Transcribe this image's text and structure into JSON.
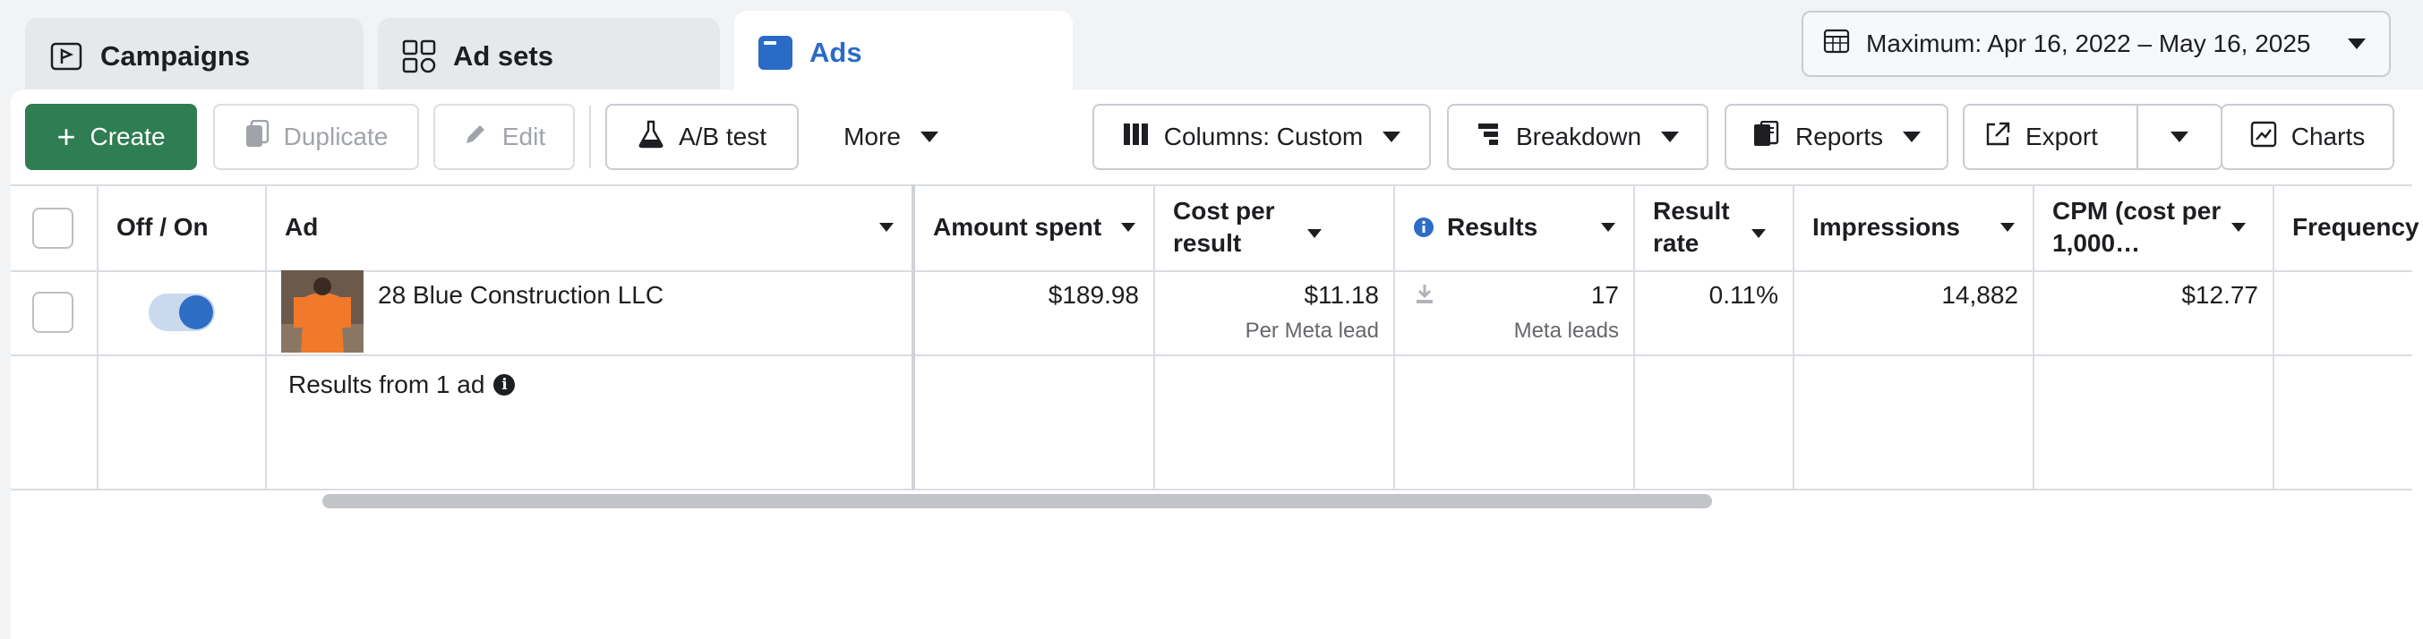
{
  "tabs": [
    {
      "label": "Campaigns",
      "icon": "campaign-flag-icon"
    },
    {
      "label": "Ad sets",
      "icon": "grid-icon"
    },
    {
      "label": "Ads",
      "icon": "ad-window-icon",
      "active": true
    }
  ],
  "date_range": {
    "label": "Maximum: Apr 16, 2022 – May 16, 2025",
    "icon": "calendar-icon"
  },
  "toolbar": {
    "create": "Create",
    "duplicate": "Duplicate",
    "edit": "Edit",
    "ab_test": "A/B test",
    "more": "More",
    "columns": "Columns: Custom",
    "breakdown": "Breakdown",
    "reports": "Reports",
    "export": "Export",
    "charts": "Charts"
  },
  "table": {
    "headers": {
      "toggle": "Off / On",
      "ad": "Ad",
      "amount_spent": "Amount spent",
      "cost_per_result": "Cost per result",
      "results": "Results",
      "result_rate": "Result rate",
      "impressions": "Impressions",
      "cpm": "CPM (cost per 1,000…",
      "frequency": "Frequency"
    },
    "row": {
      "ad_name": "28 Blue Construction LLC",
      "toggle_on": true,
      "amount_spent": "$189.98",
      "cost_per_result": "$11.18",
      "cost_per_result_sub": "Per Meta lead",
      "results": "17",
      "results_sub": "Meta leads",
      "result_rate": "0.11%",
      "impressions": "14,882",
      "cpm": "$12.77"
    },
    "summary": {
      "label": "Results from 1 ad"
    }
  },
  "colors": {
    "primary": "#2f7d52",
    "active_tab": "#2a6bc7",
    "toggle": "#2d6dc4"
  }
}
